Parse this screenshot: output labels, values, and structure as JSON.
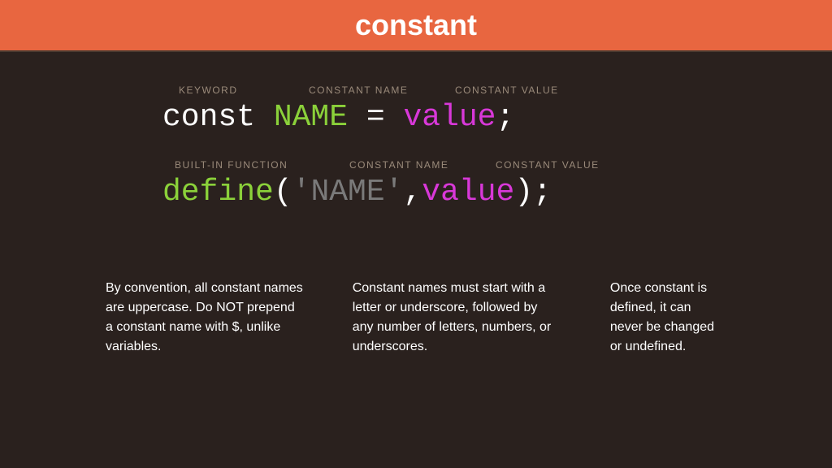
{
  "header": {
    "title": "constant"
  },
  "block1": {
    "labels": {
      "keyword": "KEYWORD",
      "name": "CONSTANT NAME",
      "value": "CONSTANT VALUE"
    },
    "code": {
      "const": "const ",
      "name": "NAME",
      "equals": " = ",
      "value": "value",
      "semi": ";"
    }
  },
  "block2": {
    "labels": {
      "func": "BUILT-IN FUNCTION",
      "name": "CONSTANT NAME",
      "value": "CONSTANT VALUE"
    },
    "code": {
      "define": "define",
      "open": "(",
      "quoted": "'NAME'",
      "comma": ",",
      "value": "value",
      "close": ")",
      "semi": ";"
    }
  },
  "notes": {
    "n1": "By convention, all constant names are uppercase. Do NOT prepend a constant name with $, unlike variables.",
    "n2": "Constant names must start with a letter or underscore, followed by any number of letters, numbers, or underscores.",
    "n3": "Once constant is defined, it can never be changed or undefined."
  }
}
